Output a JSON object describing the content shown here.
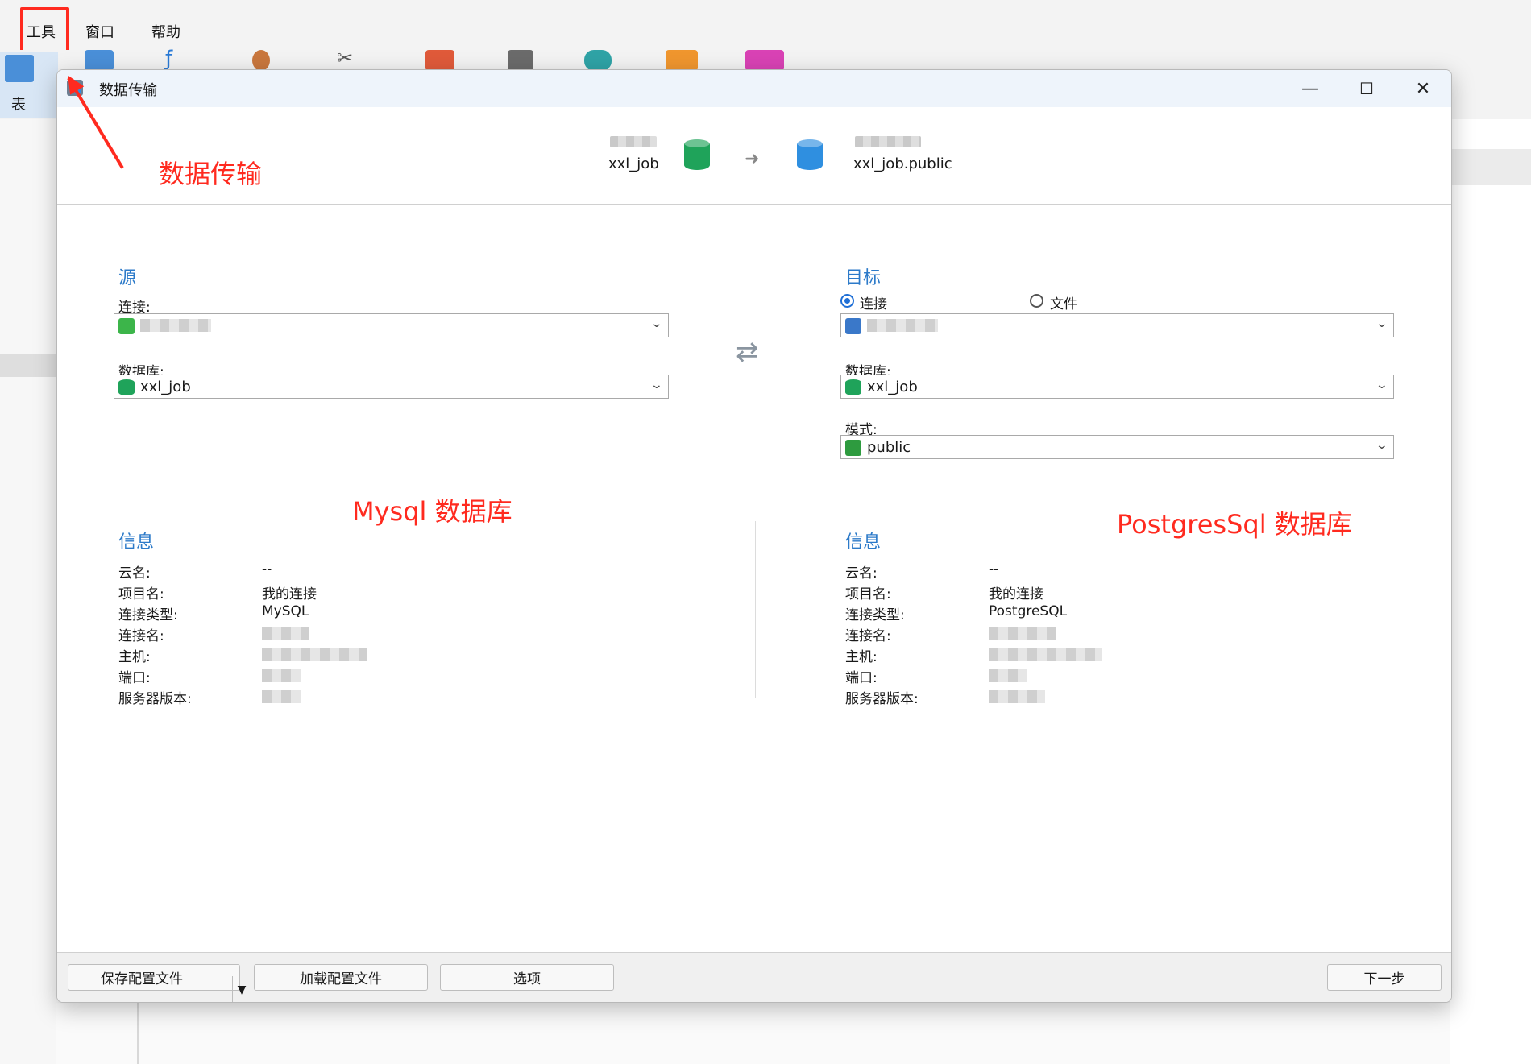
{
  "menubar": {
    "items": [
      "工具",
      "窗口",
      "帮助"
    ]
  },
  "toolbar": {
    "table_label": "表"
  },
  "dialog": {
    "title": "数据传输",
    "window_buttons": {
      "minimize": "—",
      "maximize": "☐",
      "close": "✕"
    },
    "header": {
      "source_db": "xxl_job",
      "target_db": "xxl_job.public"
    },
    "source": {
      "section_title": "源",
      "connection_label": "连接:",
      "database_label": "数据库:",
      "database_value": "xxl_job"
    },
    "target": {
      "section_title": "目标",
      "radio_connection": "连接",
      "radio_file": "文件",
      "database_label": "数据库:",
      "database_value": "xxl_job",
      "schema_label": "模式:",
      "schema_value": "public"
    },
    "source_info": {
      "title": "信息",
      "rows": [
        {
          "key": "云名:",
          "value": "--"
        },
        {
          "key": "项目名:",
          "value": "我的连接"
        },
        {
          "key": "连接类型:",
          "value": "MySQL"
        },
        {
          "key": "连接名:",
          "value": ""
        },
        {
          "key": "主机:",
          "value": ""
        },
        {
          "key": "端口:",
          "value": ""
        },
        {
          "key": "服务器版本:",
          "value": ""
        }
      ]
    },
    "target_info": {
      "title": "信息",
      "rows": [
        {
          "key": "云名:",
          "value": "--"
        },
        {
          "key": "项目名:",
          "value": "我的连接"
        },
        {
          "key": "连接类型:",
          "value": "PostgreSQL"
        },
        {
          "key": "连接名:",
          "value": ""
        },
        {
          "key": "主机:",
          "value": ""
        },
        {
          "key": "端口:",
          "value": ""
        },
        {
          "key": "服务器版本:",
          "value": ""
        }
      ]
    },
    "footer": {
      "save_config": "保存配置文件",
      "load_config": "加载配置文件",
      "options": "选项",
      "next": "下一步"
    }
  },
  "annotations": {
    "data_transfer": "数据传输",
    "mysql": "Mysql 数据库",
    "postgres": "PostgresSql 数据库"
  },
  "colors": {
    "accent": "#2c7ac9",
    "annotation": "#ff2a1f",
    "mysql_db": "#1fa35a",
    "pg_db": "#2f8fe0"
  }
}
